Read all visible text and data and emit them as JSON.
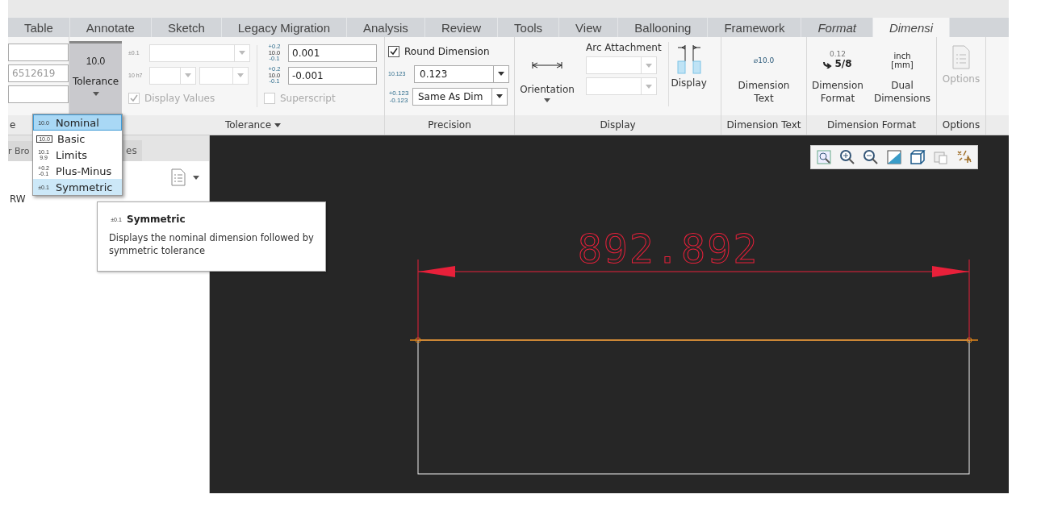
{
  "tabs": [
    {
      "label": "Table",
      "kind": "standard",
      "selected": false
    },
    {
      "label": "Annotate",
      "kind": "standard",
      "selected": false
    },
    {
      "label": "Sketch",
      "kind": "standard",
      "selected": false
    },
    {
      "label": "Legacy Migration",
      "kind": "standard",
      "selected": false
    },
    {
      "label": "Analysis",
      "kind": "standard",
      "selected": false
    },
    {
      "label": "Review",
      "kind": "standard",
      "selected": false
    },
    {
      "label": "Tools",
      "kind": "standard",
      "selected": false
    },
    {
      "label": "View",
      "kind": "standard",
      "selected": false
    },
    {
      "label": "Ballooning",
      "kind": "standard",
      "selected": false
    },
    {
      "label": "Framework",
      "kind": "standard",
      "selected": false
    },
    {
      "label": "Format",
      "kind": "contextual",
      "selected": false
    },
    {
      "label": "Dimensi",
      "kind": "contextual",
      "selected": true
    }
  ],
  "ribbon": {
    "partial_group": {
      "label": "e",
      "field_value": "6512619"
    },
    "tolerance_button": {
      "icon_text": "10.0",
      "label": "Tolerance",
      "expanded": true
    },
    "tolerance_group": {
      "label": "Tolerance",
      "table_icon_text": "±0.1",
      "fit_icon_text": "10 h7",
      "display_values": {
        "label": "Display Values",
        "checked": true,
        "disabled": true
      },
      "upper": {
        "icon_text": [
          "+0.2",
          "10.0",
          "-0.1"
        ],
        "value": "0.001"
      },
      "lower": {
        "icon_text": [
          "+0.2",
          "10.0",
          "-0.1"
        ],
        "value": "-0.001"
      },
      "superscript": {
        "label": "Superscript",
        "checked": false,
        "disabled": true
      }
    },
    "precision_group": {
      "label": "Precision",
      "round_dimension": {
        "label": "Round Dimension",
        "checked": true,
        "disabled": false
      },
      "decimals": {
        "icon_text": "10.123",
        "value": "0.123"
      },
      "tolerance_decimals": {
        "icon_text": [
          "+0.123",
          "-0.123"
        ],
        "value": "Same As Dim"
      }
    },
    "display_group": {
      "label": "Display",
      "orientation": "Orientation",
      "arc_attachment": "Arc Attachment",
      "display": "Display"
    },
    "dimension_text_group": {
      "label": "Dimension Text",
      "icon_text": "⌀10.0",
      "button": "Dimension Text"
    },
    "dimension_format_group": {
      "label": "Dimension Format",
      "format_icon_text": [
        "0.12",
        "5/8"
      ],
      "format_button": "Dimension Format",
      "dual_icon_text": [
        "inch",
        "[mm]"
      ],
      "dual_button": "Dual Dimensions"
    },
    "options_group": {
      "label": "Options",
      "button": "Options",
      "disabled": true
    }
  },
  "tolerance_menu": [
    {
      "icon_text": "10.0",
      "label": "Nominal",
      "selected": true,
      "hovered": false
    },
    {
      "icon_text": "10.0",
      "label": "Basic",
      "selected": false,
      "hovered": false
    },
    {
      "icon_text": "10.1 9.9",
      "label": "Limits",
      "selected": false,
      "hovered": false
    },
    {
      "icon_text": "+0.2 -0.1",
      "label": "Plus-Minus",
      "selected": false,
      "hovered": false
    },
    {
      "icon_text": "±0.1",
      "label": "Symmetric",
      "selected": false,
      "hovered": true
    }
  ],
  "tooltip": {
    "icon_text": "±0.1",
    "title": "Symmetric",
    "text": "Displays the nominal dimension followed by symmetric tolerance"
  },
  "left_panel": {
    "tabs": [
      "r Bro",
      "es"
    ],
    "tree_items": [
      "RW"
    ]
  },
  "canvas": {
    "dimension_value": "892.892"
  }
}
